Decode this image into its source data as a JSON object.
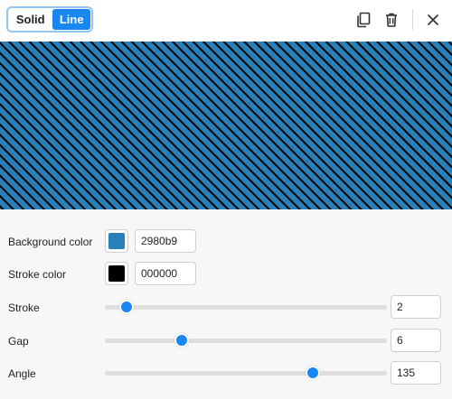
{
  "mode_toggle": {
    "options": [
      "Solid",
      "Line"
    ],
    "selected": "Line"
  },
  "toolbar": {
    "copy_icon": "copy-icon",
    "delete_icon": "trash-icon",
    "close_icon": "close-icon"
  },
  "preview": {
    "background_color": "#2980b9",
    "stroke_color": "#000000",
    "stroke_width": 2,
    "gap": 6,
    "angle": 135
  },
  "controls": {
    "background": {
      "label": "Background color",
      "value": "2980b9",
      "color": "#2980b9"
    },
    "stroke_color": {
      "label": "Stroke color",
      "value": "000000",
      "color": "#000000"
    },
    "stroke": {
      "label": "Stroke",
      "value": "2",
      "level": 0.077
    },
    "gap": {
      "label": "Gap",
      "value": "6",
      "level": 0.273
    },
    "angle": {
      "label": "Angle",
      "value": "135",
      "level": 0.737
    }
  },
  "colors": {
    "accent": "#1a86f1",
    "toggle_border": "#93c5f3"
  }
}
